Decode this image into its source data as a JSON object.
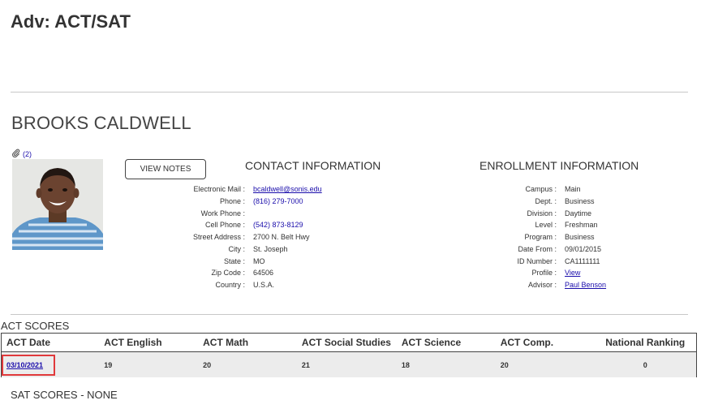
{
  "page": {
    "title": "Adv: ACT/SAT"
  },
  "student": {
    "name": "BROOKS CALDWELL",
    "attachments_count": "(2)",
    "view_notes_label": "VIEW NOTES"
  },
  "contact": {
    "heading": "CONTACT INFORMATION",
    "rows": [
      {
        "label": "Electronic Mail :",
        "value": "bcaldwell@sonis.edu"
      },
      {
        "label": "Phone :",
        "value": "(816) 279-7000"
      },
      {
        "label": "Work Phone :",
        "value": ""
      },
      {
        "label": "Cell Phone :",
        "value": "(542) 873-8129"
      },
      {
        "label": "Street Address :",
        "value": "2700 N. Belt Hwy"
      },
      {
        "label": "City :",
        "value": "St. Joseph"
      },
      {
        "label": "State :",
        "value": "MO"
      },
      {
        "label": "Zip Code :",
        "value": "64506"
      },
      {
        "label": "Country :",
        "value": "U.S.A."
      }
    ]
  },
  "enrollment": {
    "heading": "ENROLLMENT INFORMATION",
    "rows": [
      {
        "label": "Campus :",
        "value": "Main"
      },
      {
        "label": "Dept. :",
        "value": "Business"
      },
      {
        "label": "Division :",
        "value": "Daytime"
      },
      {
        "label": "Level :",
        "value": "Freshman"
      },
      {
        "label": "Program :",
        "value": "Business"
      },
      {
        "label": "Date From :",
        "value": "09/01/2015"
      },
      {
        "label": "ID Number :",
        "value": "CA1111111"
      },
      {
        "label": "Profile :",
        "value": "View"
      },
      {
        "label": "Advisor :",
        "value": "Paul Benson"
      }
    ]
  },
  "act_scores": {
    "title": "ACT SCORES",
    "columns": [
      "ACT Date",
      "ACT English",
      "ACT Math",
      "ACT Social Studies",
      "ACT Science",
      "ACT Comp.",
      "National Ranking"
    ],
    "rows": [
      [
        "03/10/2021",
        "19",
        "20",
        "21",
        "18",
        "20",
        "0"
      ]
    ]
  },
  "sat_scores": {
    "title": "SAT SCORES - NONE"
  },
  "colors": {
    "link": "#1a0dab",
    "highlight": "#e0393b",
    "row_bg": "#ececec"
  }
}
